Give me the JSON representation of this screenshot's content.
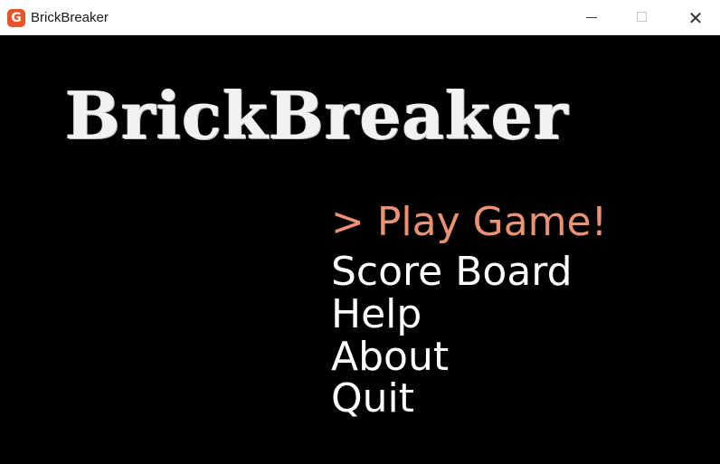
{
  "window": {
    "title": "BrickBreaker",
    "app_icon": "monogame-icon",
    "controls": {
      "minimize": "minimize-icon",
      "maximize": "maximize-icon",
      "close": "✕"
    }
  },
  "game": {
    "logo_text": "BrickBreaker",
    "menu": {
      "selected_index": 0,
      "items": [
        {
          "label": "> Play Game!"
        },
        {
          "label": "Score Board"
        },
        {
          "label": "Help"
        },
        {
          "label": "About"
        },
        {
          "label": "Quit"
        }
      ]
    },
    "colors": {
      "background": "#000000",
      "menu_text": "#ffffff",
      "menu_selected": "#eb9272",
      "logo": "#f2f2f2"
    }
  }
}
